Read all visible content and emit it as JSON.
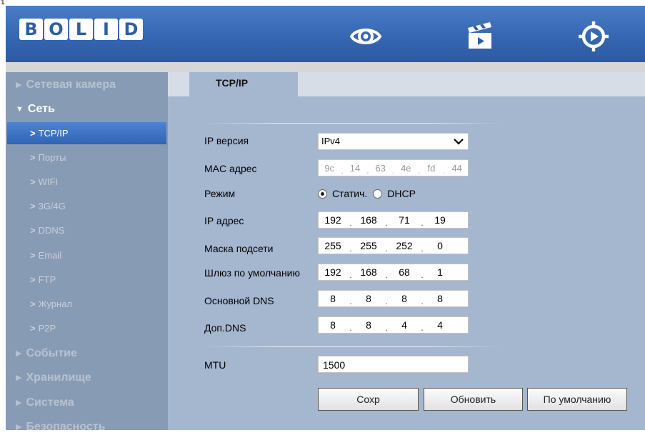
{
  "corner_text": "1",
  "header": {
    "logo_letters": [
      "B",
      "O",
      "L",
      "I",
      "D"
    ],
    "icons": [
      "live-view-eye-icon",
      "playback-clapperboard-icon",
      "setup-target-icon"
    ],
    "color": "#3465b0"
  },
  "sidebar": {
    "groups_top": [
      {
        "label": "Сетевая камера",
        "open": false
      },
      {
        "label": "Сеть",
        "open": true
      }
    ],
    "sub_items": [
      {
        "label": "TCP/IP",
        "active": true
      },
      {
        "label": "Порты",
        "active": false
      },
      {
        "label": "WIFI",
        "active": false
      },
      {
        "label": "3G/4G",
        "active": false
      },
      {
        "label": "DDNS",
        "active": false
      },
      {
        "label": "Email",
        "active": false
      },
      {
        "label": "FTP",
        "active": false
      },
      {
        "label": "Журнал",
        "active": false
      },
      {
        "label": "P2P",
        "active": false
      }
    ],
    "groups_bottom": [
      {
        "label": "Событие"
      },
      {
        "label": "Хранилище"
      },
      {
        "label": "Система"
      },
      {
        "label": "Безопасность"
      }
    ]
  },
  "tab": {
    "label": "TCP/IP"
  },
  "form": {
    "ip_version": {
      "label": "IP версия",
      "value": "IPv4"
    },
    "mac": {
      "label": "MAC адрес",
      "octets": [
        "9c",
        "14",
        "63",
        "4e",
        "fd",
        "44"
      ]
    },
    "mode": {
      "label": "Режим",
      "options": [
        "Статич.",
        "DHCP"
      ],
      "selected": "Статич."
    },
    "ip": {
      "label": "IP адрес",
      "octets": [
        "192",
        "168",
        "71",
        "19"
      ]
    },
    "mask": {
      "label": "Маска подсети",
      "octets": [
        "255",
        "255",
        "252",
        "0"
      ]
    },
    "gateway": {
      "label": "Шлюз по умолчанию",
      "octets": [
        "192",
        "168",
        "68",
        "1"
      ]
    },
    "dns1": {
      "label": "Основной DNS",
      "octets": [
        "8",
        "8",
        "8",
        "8"
      ]
    },
    "dns2": {
      "label": "Доп.DNS",
      "octets": [
        "8",
        "8",
        "4",
        "4"
      ]
    },
    "mtu": {
      "label": "MTU",
      "value": "1500"
    }
  },
  "buttons": {
    "save": "Сохр",
    "refresh": "Обновить",
    "default": "По умолчанию"
  }
}
